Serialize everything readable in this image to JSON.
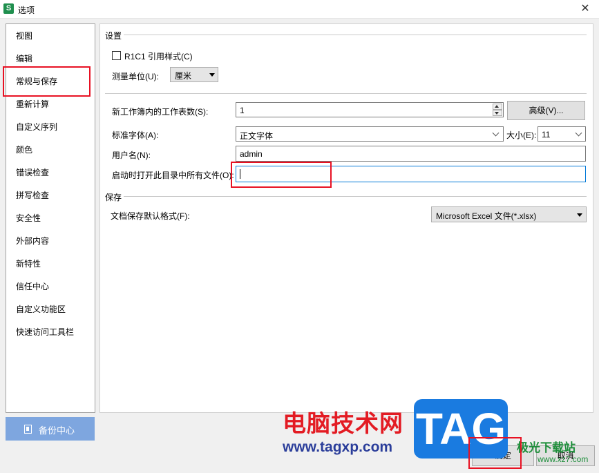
{
  "window": {
    "title": "选项",
    "app_icon_letter": "S",
    "close_glyph": "✕"
  },
  "sidebar": {
    "items": [
      {
        "label": "视图"
      },
      {
        "label": "编辑"
      },
      {
        "label": "常规与保存",
        "selected": true
      },
      {
        "label": "重新计算"
      },
      {
        "label": "自定义序列"
      },
      {
        "label": "颜色"
      },
      {
        "label": "错误检查"
      },
      {
        "label": "拼写检查"
      },
      {
        "label": "安全性"
      },
      {
        "label": "外部内容"
      },
      {
        "label": "新特性"
      },
      {
        "label": "信任中心"
      },
      {
        "label": "自定义功能区"
      },
      {
        "label": "快速访问工具栏"
      }
    ]
  },
  "backup_button": {
    "label": "备份中心",
    "icon": "backup-icon"
  },
  "settings": {
    "section_title": "设置",
    "r1c1_label": "R1C1 引用样式(C)",
    "r1c1_checked": false,
    "unit_label": "测量单位(U):",
    "unit_value": "厘米",
    "sheets_label": "新工作簿内的工作表数(S):",
    "sheets_value": "1",
    "advanced_button": "高级(V)...",
    "font_label": "标准字体(A):",
    "font_value": "正文字体",
    "size_label": "大小(E):",
    "size_value": "11",
    "username_label": "用户名(N):",
    "username_value": "admin",
    "startup_label": "启动时打开此目录中所有文件(O):",
    "startup_value": ""
  },
  "save": {
    "section_title": "保存",
    "format_label": "文档保存默认格式(F):",
    "format_value": "Microsoft Excel 文件(*.xlsx)"
  },
  "footer": {
    "ok_label": "确定",
    "cancel_label": "取消"
  },
  "watermark": {
    "site_name": "电脑技术网",
    "site_url": "www.tagxp.com",
    "logo_text": "TAG",
    "dl_name": "极光下载站",
    "dl_url": "www.xz7.com"
  },
  "colors": {
    "highlight_red": "#e81123",
    "backup_blue": "#7ea6df",
    "app_green": "#1f8f4e"
  }
}
